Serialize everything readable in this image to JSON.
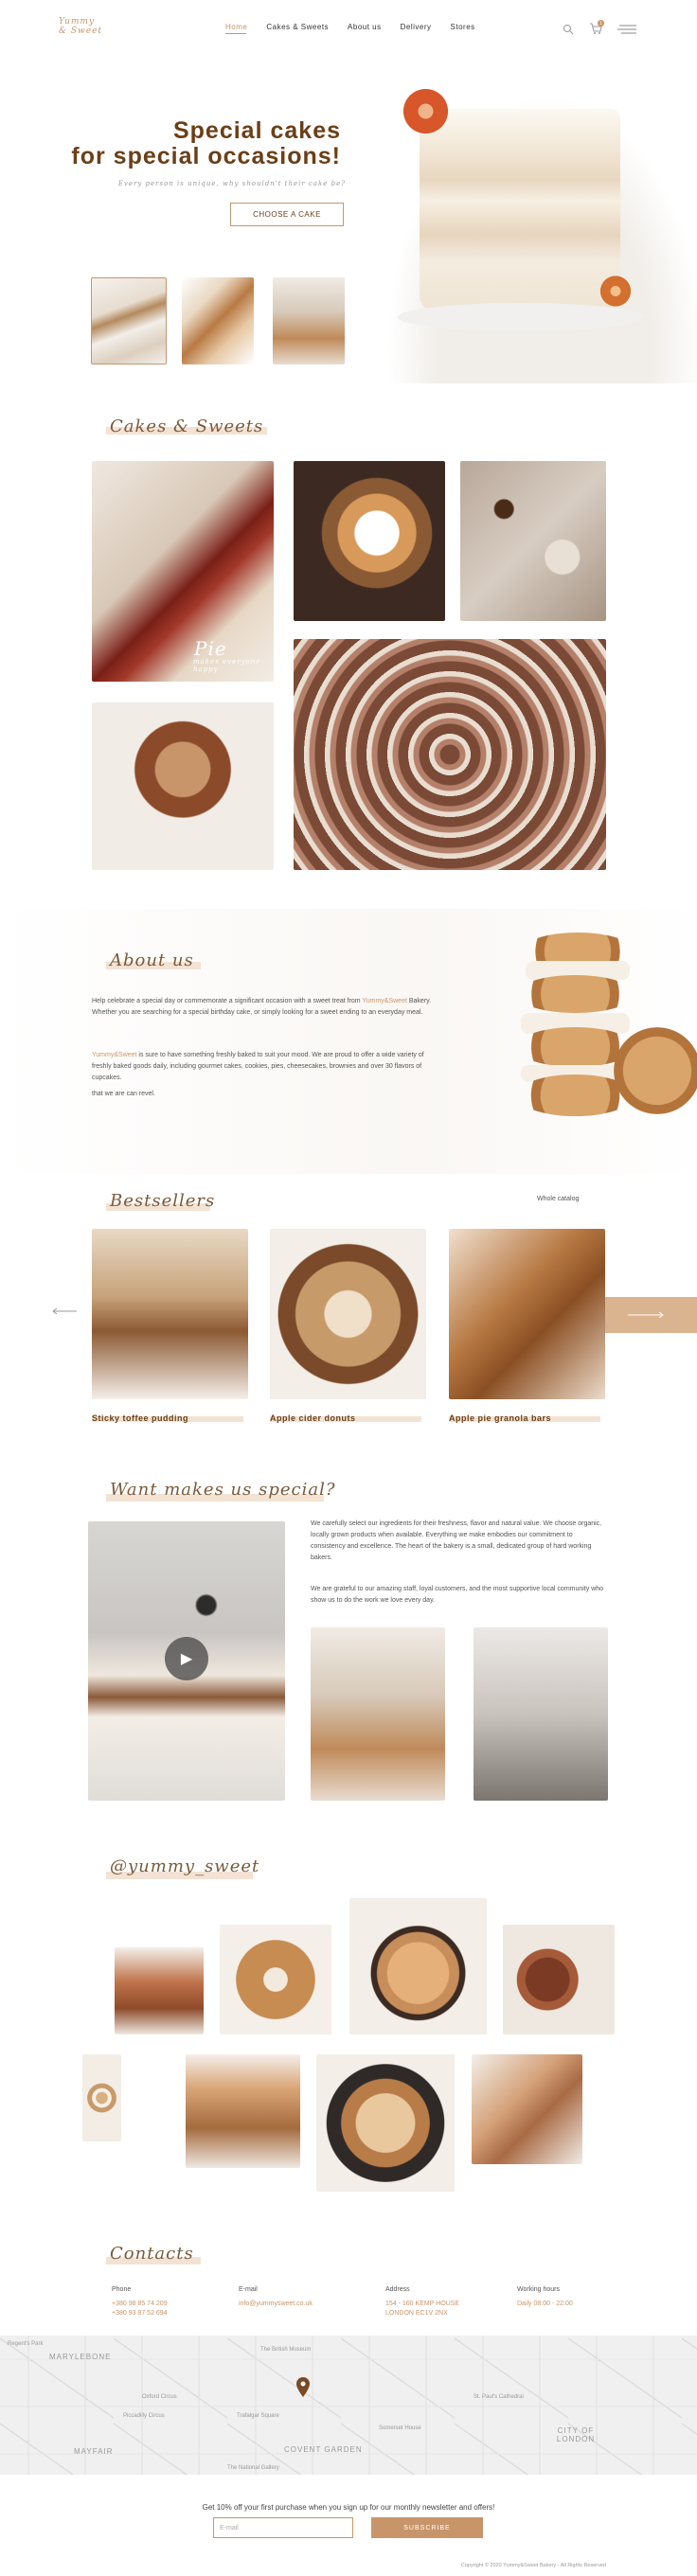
{
  "brand": {
    "logo_text": "Yummy & Sweet"
  },
  "nav": {
    "items": [
      "Home",
      "Cakes & Sweets",
      "About us",
      "Delivery",
      "Stores"
    ],
    "cart_count": "1"
  },
  "hero": {
    "title_line1": "Special cakes",
    "title_line2": "for special occasions!",
    "subtitle": "Every person is unique, why shouldn't their cake be?",
    "cta": "CHOOSE A CAKE"
  },
  "cakes_section": {
    "heading": "Cakes & Sweets",
    "pie_caption_big": "Pie",
    "pie_caption_small": "makes everyone happy"
  },
  "about": {
    "heading": "About us",
    "para1_pre": "Help celebrate a special day or commemorate a significant occasion with a sweet treat from ",
    "brand": "Yummy&Sweet",
    "para1_post": " Bakery. Whether you are searching for a special birthday cake, or simply looking for a sweet ending to an everyday meal.",
    "para2_post": " is sure to have something freshly baked to suit your mood. We are proud to offer a wide variety of freshly baked goods daily, including gourmet cakes, cookies, pies, cheesecakes, brownies and over 30 flavors of cupcakes.",
    "para3": "that we are can revel."
  },
  "bestsellers": {
    "heading": "Bestsellers",
    "catalog_link": "Whole catalog",
    "items": [
      "Sticky toffee pudding",
      "Apple cider donuts",
      "Apple pie granola bars"
    ]
  },
  "special": {
    "heading": "Want makes us special?",
    "para1": "We carefully select our ingredients for their freshness, flavor and natural value. We choose organic, locally grown products when available. Everything we make embodies our commitment to consistency and excellence. The heart of the bakery is a small, dedicated group of hard working bakers.",
    "para2": "We are grateful to our amazing staff, loyal customers, and the most supportive local community who show us to do the work we love every day."
  },
  "instagram": {
    "heading": "@yummy_sweet"
  },
  "contacts": {
    "heading": "Contacts",
    "phone_label": "Phone",
    "phone1": "+380 98 85 74 209",
    "phone2": "+380 93 87 52 694",
    "email_label": "E-mail",
    "email": "info@yummysweet.co.uk",
    "address_label": "Address",
    "address1": "154 - 160 KEMP HOUSE",
    "address2": "LONDON EC1V 2NX",
    "hours_label": "Working hours",
    "hours": "Daily 08:00 - 22:00"
  },
  "map": {
    "labels": [
      "MARYLEBONE",
      "MAYFAIR",
      "COVENT GARDEN",
      "CITY OF LONDON",
      "Oxford Circus",
      "The British Museum",
      "Somerset House",
      "St. Paul's Cathedral",
      "Regent's Park",
      "Piccadilly Circus",
      "Trafalgar Square",
      "The National Gallery"
    ]
  },
  "newsletter": {
    "text": "Get 10% off your first purchase when you sign up for our monthly newsletter and offers!",
    "placeholder": "E-mail",
    "button": "SUBSCRIBE"
  },
  "footer": {
    "copyright": "Copyright © 2020 Yummy&Sweet Bakery - All Rights Reserved"
  },
  "colors": {
    "accent": "#c8956a",
    "brown": "#6b3f17",
    "highlight": "#f3e3d4"
  }
}
